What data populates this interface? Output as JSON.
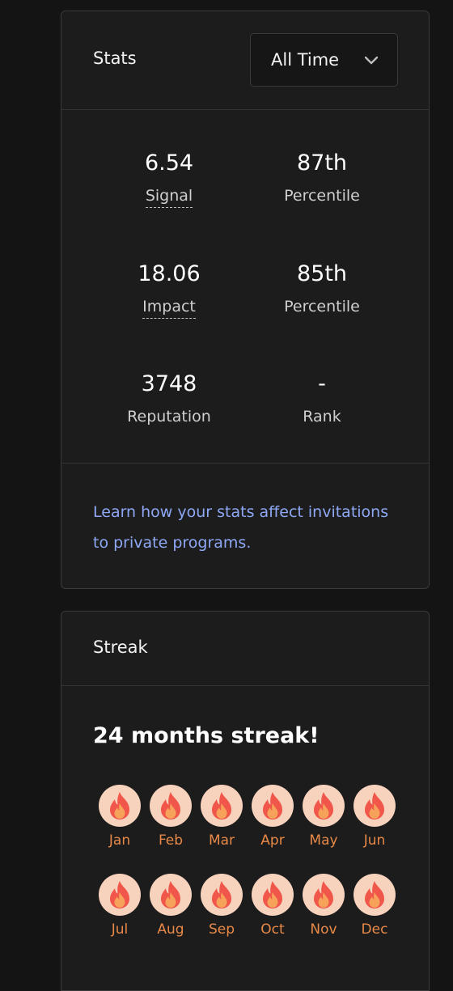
{
  "stats": {
    "title": "Stats",
    "range": "All Time",
    "items": [
      {
        "value": "6.54",
        "label": "Signal"
      },
      {
        "value": "87th",
        "label": "Percentile"
      },
      {
        "value": "18.06",
        "label": "Impact"
      },
      {
        "value": "85th",
        "label": "Percentile"
      },
      {
        "value": "3748",
        "label": "Reputation"
      },
      {
        "value": "-",
        "label": "Rank"
      }
    ],
    "link": "Learn how your stats affect invitations to private programs."
  },
  "streak": {
    "title": "Streak",
    "heading": "24 months streak!",
    "months": [
      "Jan",
      "Feb",
      "Mar",
      "Apr",
      "May",
      "Jun",
      "Jul",
      "Aug",
      "Sep",
      "Oct",
      "Nov",
      "Dec"
    ]
  },
  "colors": {
    "background": "#141414",
    "card": "#1c1c1c",
    "link": "#8ea8f5",
    "badge": "#f7d2bd",
    "flame_outer": "#f0574a",
    "flame_inner": "#f7a25a",
    "month_label": "#e88948"
  }
}
